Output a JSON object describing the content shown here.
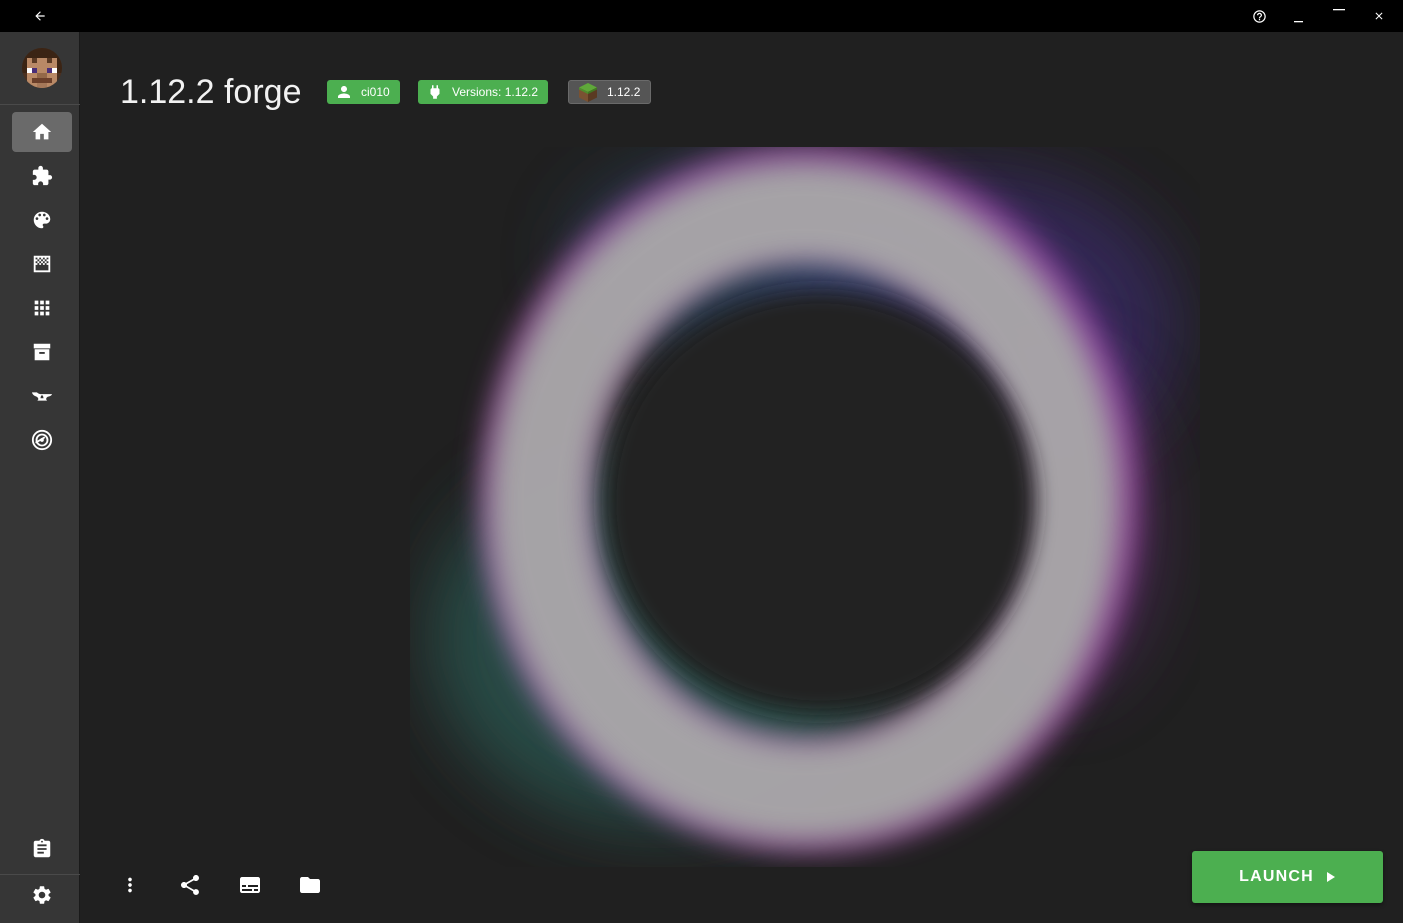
{
  "window": {
    "back_icon": "arrow-left-icon",
    "help_icon": "help-circle-icon",
    "minimize_icon": "minimize-icon",
    "maximize_icon": "maximize-icon",
    "close_icon": "close-icon"
  },
  "sidebar": {
    "avatar_icon": "player-skin-avatar",
    "items": [
      {
        "name": "home",
        "icon": "home-icon",
        "active": true
      },
      {
        "name": "mods",
        "icon": "puzzle-icon",
        "active": false
      },
      {
        "name": "resourcepacks",
        "icon": "palette-icon",
        "active": false
      },
      {
        "name": "shaderpacks",
        "icon": "texture-icon",
        "active": false
      },
      {
        "name": "modpacks",
        "icon": "grid-icon",
        "active": false
      },
      {
        "name": "saves",
        "icon": "archive-icon",
        "active": false
      },
      {
        "name": "curseforge",
        "icon": "anvil-icon",
        "active": false
      },
      {
        "name": "modrinth",
        "icon": "modrinth-icon",
        "active": false
      }
    ],
    "bottom_items": [
      {
        "name": "tasks",
        "icon": "clipboard-icon"
      },
      {
        "name": "settings",
        "icon": "gear-icon"
      }
    ]
  },
  "instance": {
    "title": "1.12.2 forge",
    "chips": {
      "user": "ci010",
      "versions": "Versions: 1.12.2",
      "minecraft": "1.12.2"
    }
  },
  "actions": {
    "more_icon": "dots-vertical-icon",
    "share_icon": "share-icon",
    "log_icon": "subtitles-icon",
    "folder_icon": "folder-icon",
    "launch_label": "LAUNCH",
    "launch_icon": "play-triangle-icon"
  },
  "colors": {
    "accent": "#4caf50",
    "background": "#202020",
    "sidebar": "#363636",
    "titlebar": "#000000"
  }
}
